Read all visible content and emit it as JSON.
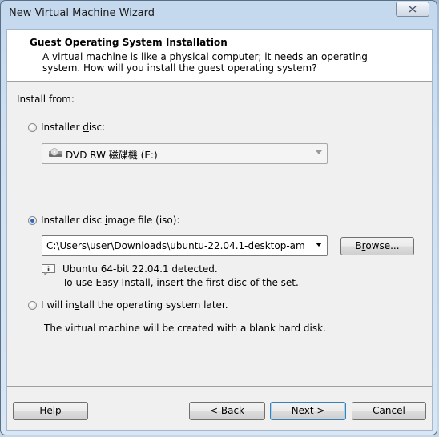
{
  "window": {
    "title": "New Virtual Machine Wizard"
  },
  "header": {
    "title": "Guest Operating System Installation",
    "desc_line1": "A virtual machine is like a physical computer; it needs an operating",
    "desc_line2": "system. How will you install the guest operating system?"
  },
  "install_from_label": "Install from:",
  "options": {
    "disc": {
      "label_pre": "Installer ",
      "label_key": "d",
      "label_post": "isc:",
      "selected": false,
      "drive_value": "DVD RW 磁碟機 (E:)"
    },
    "iso": {
      "label_pre": "Installer disc ",
      "label_key": "i",
      "label_post": "mage file (iso):",
      "selected": true,
      "path_value": "C:\\Users\\user\\Downloads\\ubuntu-22.04.1-desktop-am",
      "browse_pre": "B",
      "browse_key": "r",
      "browse_post": "owse...",
      "detect_line1": "Ubuntu 64-bit 22.04.1 detected.",
      "detect_line2": "To use Easy Install, insert the first disc of the set."
    },
    "later": {
      "label_pre": "I will in",
      "label_key": "s",
      "label_post": "tall the operating system later.",
      "selected": false,
      "note": "The virtual machine will be created with a blank hard disk."
    }
  },
  "footer": {
    "help": "Help",
    "back_pre": "< ",
    "back_key": "B",
    "back_post": "ack",
    "next_key": "N",
    "next_post": "ext >",
    "cancel": "Cancel"
  },
  "colors": {
    "selected_radio": "#2d67c5",
    "header_bg": "#ffffff",
    "dialog_bg": "#f0f0f0"
  }
}
